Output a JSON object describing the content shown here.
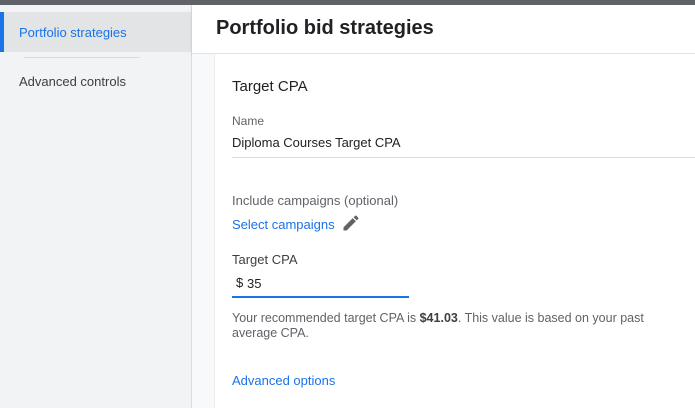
{
  "sidebar": {
    "items": [
      {
        "label": "Portfolio strategies",
        "active": true
      },
      {
        "label": "Advanced controls",
        "active": false
      }
    ]
  },
  "header": {
    "title": "Portfolio bid strategies"
  },
  "form": {
    "section_title": "Target CPA",
    "name_label": "Name",
    "name_value": "Diploma Courses Target CPA",
    "include_label": "Include campaigns (optional)",
    "select_campaigns_label": "Select campaigns",
    "edit_icon": "pencil-icon",
    "target_cpa_label": "Target CPA",
    "currency_symbol": "$",
    "target_cpa_value": "35",
    "recommendation": {
      "prefix": "Your recommended target CPA is ",
      "value": "$41.03",
      "suffix": ". This value is based on your past average CPA."
    },
    "advanced_options_label": "Advanced options"
  },
  "colors": {
    "accent": "#1a73e8",
    "sidebar_bg": "#f1f3f4",
    "text_primary": "#202124",
    "text_secondary": "#5f6368"
  }
}
